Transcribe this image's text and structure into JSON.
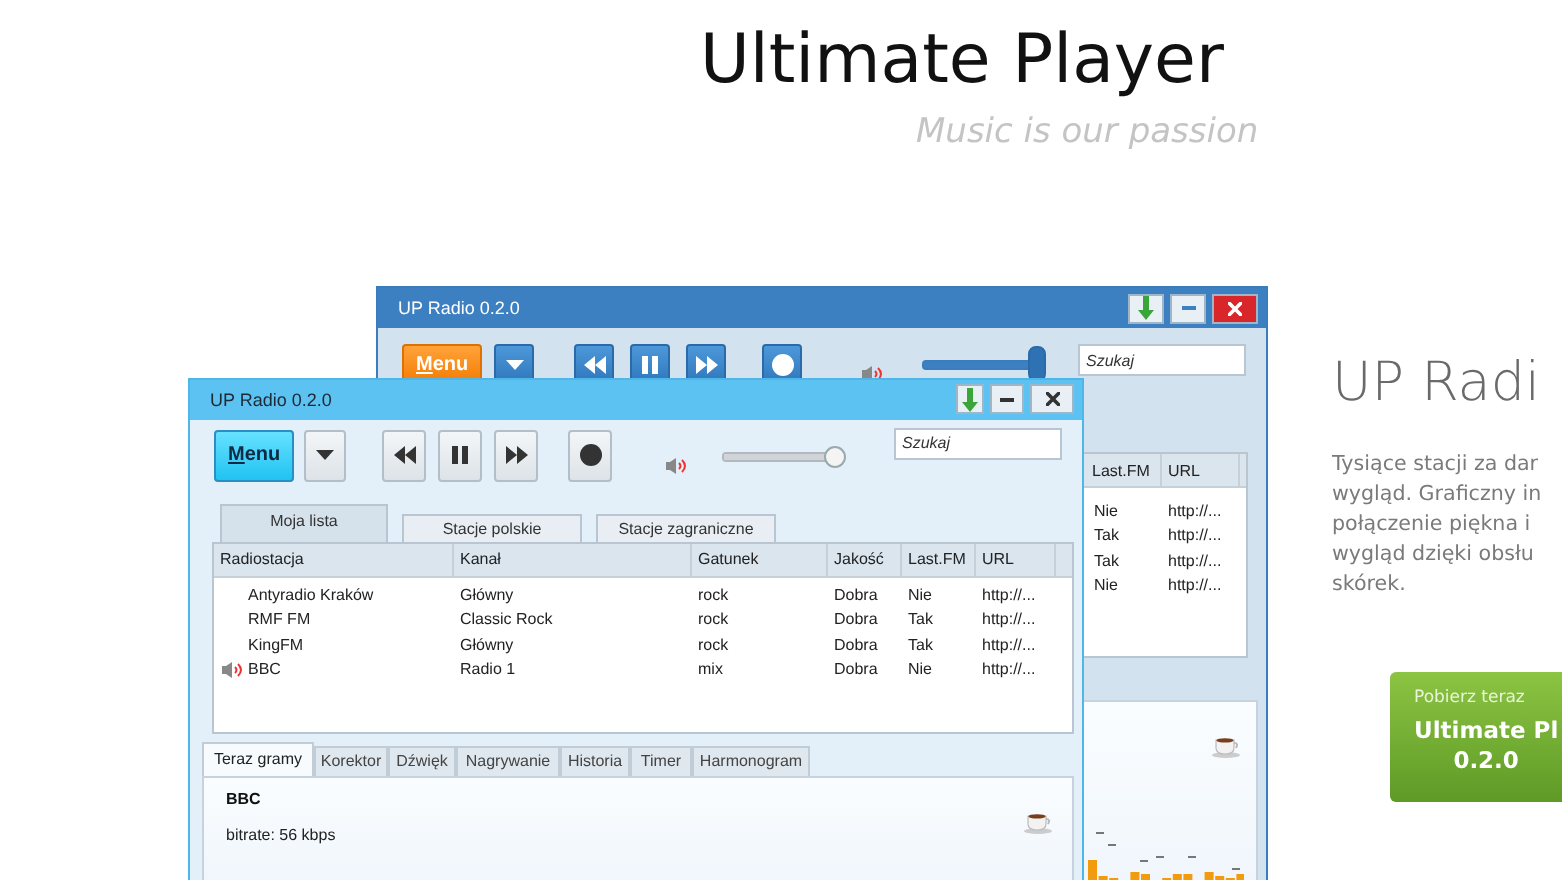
{
  "header": {
    "title": "Ultimate Player",
    "tagline": "Music is our passion"
  },
  "back_window": {
    "title": "UP Radio 0.2.0",
    "menu_label": "Menu",
    "volume": {
      "level": 0.95
    },
    "search": {
      "placeholder": "Szukaj"
    },
    "columns": [
      "Last.FM",
      "URL"
    ],
    "rows": [
      [
        "Nie",
        "http://..."
      ],
      [
        "Tak",
        "http://..."
      ],
      [
        "Tak",
        "http://..."
      ],
      [
        "Nie",
        "http://..."
      ]
    ]
  },
  "front_window": {
    "title": "UP Radio 0.2.0",
    "menu_label": "Menu",
    "volume": {
      "level": 0.95
    },
    "search": {
      "placeholder": "Szukaj"
    },
    "tabs": [
      {
        "label": "Moja lista",
        "selected": true
      },
      {
        "label": "Stacje polskie",
        "selected": false
      },
      {
        "label": "Stacje zagraniczne",
        "selected": false
      }
    ],
    "columns": [
      "Radiostacja",
      "Kanał",
      "Gatunek",
      "Jakość",
      "Last.FM",
      "URL"
    ],
    "rows": [
      {
        "playing": false,
        "cells": [
          "Antyradio Kraków",
          "Główny",
          "rock",
          "Dobra",
          "Nie",
          "http://..."
        ]
      },
      {
        "playing": false,
        "cells": [
          "RMF FM",
          "Classic Rock",
          "rock",
          "Dobra",
          "Tak",
          "http://..."
        ]
      },
      {
        "playing": false,
        "cells": [
          "KingFM",
          "Główny",
          "rock",
          "Dobra",
          "Tak",
          "http://..."
        ]
      },
      {
        "playing": true,
        "cells": [
          "BBC",
          "Radio 1",
          "mix",
          "Dobra",
          "Nie",
          "http://..."
        ]
      }
    ],
    "bottom_tabs": [
      {
        "label": "Teraz gramy",
        "selected": true
      },
      {
        "label": "Korektor",
        "selected": false
      },
      {
        "label": "Dźwięk",
        "selected": false
      },
      {
        "label": "Nagrywanie",
        "selected": false
      },
      {
        "label": "Historia",
        "selected": false
      },
      {
        "label": "Timer",
        "selected": false
      },
      {
        "label": "Harmonogram",
        "selected": false
      }
    ],
    "now_playing": {
      "station": "BBC",
      "bitrate": "bitrate: 56 kbps"
    }
  },
  "promo": {
    "heading": "UP Radi",
    "lines": [
      "Tysiące stacji za dar",
      "wygląd. Graficzny in",
      "połączenie piękna i",
      "wygląd dzięki obsłu",
      "skórek."
    ],
    "button": {
      "caption": "Pobierz teraz",
      "title": "Ultimate Pl",
      "version": "0.2.0"
    }
  }
}
